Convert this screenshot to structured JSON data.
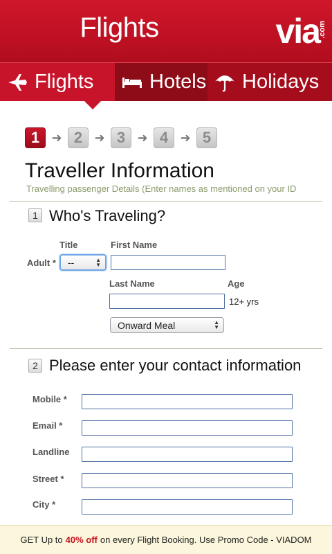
{
  "header": {
    "title": "Flights",
    "logo_text": "via",
    "logo_suffix": ".com"
  },
  "tabs": [
    {
      "label": "Flights",
      "icon": "plane-icon",
      "active": true
    },
    {
      "label": "Hotels",
      "icon": "bed-icon",
      "active": false
    },
    {
      "label": "Holidays",
      "icon": "umbrella-icon",
      "active": false
    }
  ],
  "steps": {
    "items": [
      "1",
      "2",
      "3",
      "4",
      "5"
    ],
    "current": 1
  },
  "page": {
    "title": "Traveller Information",
    "subtitle": "Travelling passenger Details (Enter names as mentioned on your ID"
  },
  "traveler_section": {
    "number": "1",
    "heading": "Who's Traveling?",
    "title_label": "Title",
    "first_name_label": "First Name",
    "row_label": "Adult *",
    "title_select_value": "--",
    "first_name_value": "",
    "last_name_label": "Last Name",
    "age_label": "Age",
    "last_name_value": "",
    "age_value": "12+ yrs",
    "meal_select_value": "Onward Meal"
  },
  "contact_section": {
    "number": "2",
    "heading": "Please enter your contact information",
    "fields": [
      {
        "label": "Mobile *",
        "value": ""
      },
      {
        "label": "Email *",
        "value": ""
      },
      {
        "label": "Landline",
        "value": ""
      },
      {
        "label": "Street *",
        "value": ""
      },
      {
        "label": "City *",
        "value": ""
      }
    ]
  },
  "promo": {
    "prefix": "GET Up to",
    "highlight": "40% off",
    "suffix": "on every Flight Booking. Use Promo Code - VIADOM"
  },
  "colors": {
    "brand_red": "#c8142a",
    "promo_bg": "#fbf6dc"
  }
}
